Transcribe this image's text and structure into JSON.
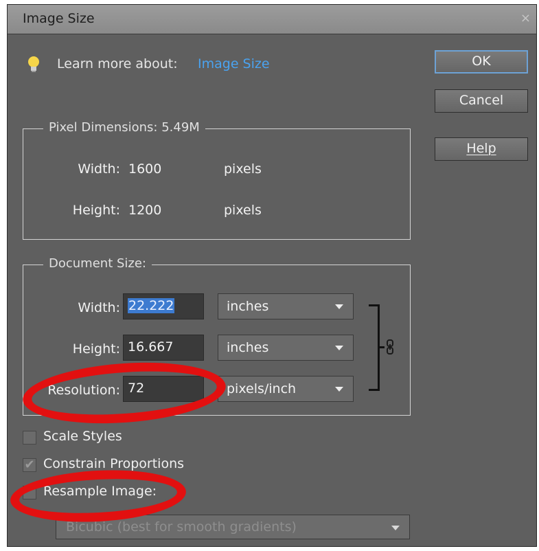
{
  "dialog": {
    "title": "Image Size",
    "close_glyph": "×"
  },
  "learn": {
    "prefix": "Learn more about:",
    "link": "Image Size"
  },
  "buttons": {
    "ok": "OK",
    "cancel": "Cancel",
    "help": "Help"
  },
  "pixel_dimensions": {
    "title": "Pixel Dimensions:  5.49M",
    "width_label": "Width:",
    "width_value": "1600",
    "width_unit": "pixels",
    "height_label": "Height:",
    "height_value": "1200",
    "height_unit": "pixels"
  },
  "document_size": {
    "title": "Document Size:",
    "width_label": "Width:",
    "width_value": "22.222",
    "width_unit": "inches",
    "height_label": "Height:",
    "height_value": "16.667",
    "height_unit": "inches",
    "resolution_label": "Resolution:",
    "resolution_value": "72",
    "resolution_unit": "pixels/inch",
    "link_icon": "chain-link-icon"
  },
  "options": {
    "scale_styles": {
      "label": "Scale Styles",
      "checked": false
    },
    "constrain_proportions": {
      "label": "Constrain Proportions",
      "checked": true
    },
    "resample_image": {
      "label": "Resample Image:",
      "checked": false
    },
    "resample_method": "Bicubic (best for smooth gradients)"
  },
  "colors": {
    "dialog_bg": "#5f5f5f",
    "link": "#4aa3f0",
    "annotation": "#e21010",
    "selection": "#3d7bd0"
  }
}
